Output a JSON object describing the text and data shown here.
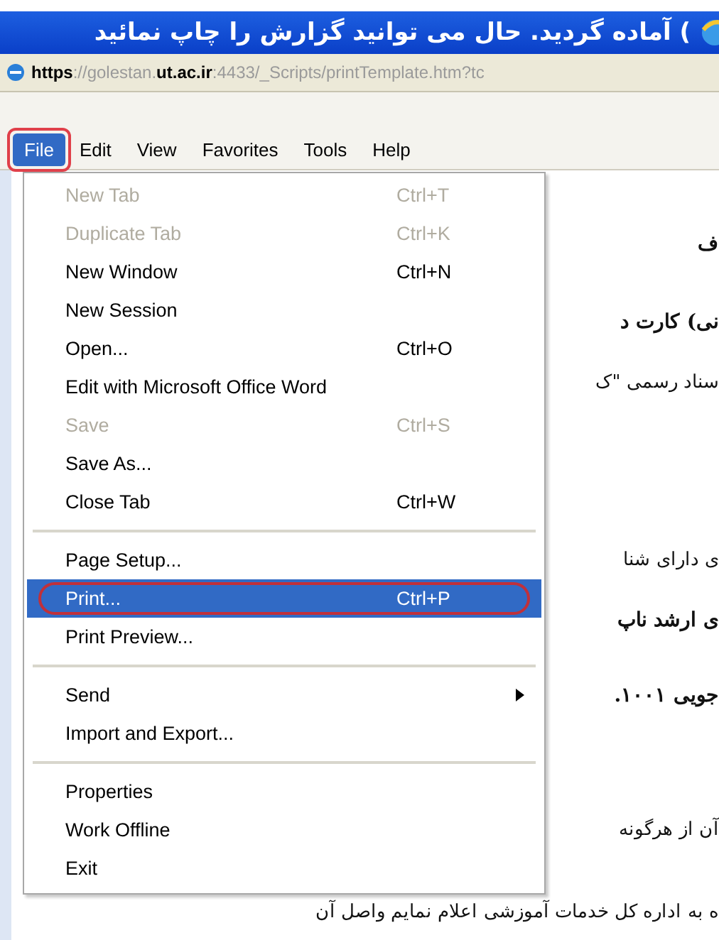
{
  "window": {
    "title": ") آماده گردید. حال می توانید گزارش را چاپ نمائید"
  },
  "address_bar": {
    "parts": [
      {
        "text": "https",
        "strong": true
      },
      {
        "text": "://golestan.",
        "strong": false
      },
      {
        "text": "ut.ac.ir",
        "strong": true
      },
      {
        "text": ":4433/_Scripts/printTemplate.htm?tc",
        "strong": false
      }
    ]
  },
  "menu_bar": [
    {
      "label": "File",
      "selected": true,
      "circled": true
    },
    {
      "label": "Edit",
      "selected": false,
      "circled": false
    },
    {
      "label": "View",
      "selected": false,
      "circled": false
    },
    {
      "label": "Favorites",
      "selected": false,
      "circled": false
    },
    {
      "label": "Tools",
      "selected": false,
      "circled": false
    },
    {
      "label": "Help",
      "selected": false,
      "circled": false
    }
  ],
  "file_menu": [
    {
      "kind": "item",
      "label": "New Tab",
      "shortcut": "Ctrl+T",
      "disabled": true,
      "selected": false,
      "circled": false,
      "submenu": false
    },
    {
      "kind": "item",
      "label": "Duplicate Tab",
      "shortcut": "Ctrl+K",
      "disabled": true,
      "selected": false,
      "circled": false,
      "submenu": false
    },
    {
      "kind": "item",
      "label": "New Window",
      "shortcut": "Ctrl+N",
      "disabled": false,
      "selected": false,
      "circled": false,
      "submenu": false
    },
    {
      "kind": "item",
      "label": "New Session",
      "disabled": false,
      "selected": false,
      "circled": false,
      "submenu": false
    },
    {
      "kind": "item",
      "label": "Open...",
      "shortcut": "Ctrl+O",
      "disabled": false,
      "selected": false,
      "circled": false,
      "submenu": false
    },
    {
      "kind": "item",
      "label": "Edit with Microsoft Office Word",
      "disabled": false,
      "selected": false,
      "circled": false,
      "submenu": false
    },
    {
      "kind": "item",
      "label": "Save",
      "shortcut": "Ctrl+S",
      "disabled": true,
      "selected": false,
      "circled": false,
      "submenu": false
    },
    {
      "kind": "item",
      "label": "Save As...",
      "disabled": false,
      "selected": false,
      "circled": false,
      "submenu": false
    },
    {
      "kind": "item",
      "label": "Close Tab",
      "shortcut": "Ctrl+W",
      "disabled": false,
      "selected": false,
      "circled": false,
      "submenu": false
    },
    {
      "kind": "separator"
    },
    {
      "kind": "item",
      "label": "Page Setup...",
      "disabled": false,
      "selected": false,
      "circled": false,
      "submenu": false
    },
    {
      "kind": "item",
      "label": "Print...",
      "shortcut": "Ctrl+P",
      "disabled": false,
      "selected": true,
      "circled": true,
      "submenu": false
    },
    {
      "kind": "item",
      "label": "Print Preview...",
      "disabled": false,
      "selected": false,
      "circled": false,
      "submenu": false
    },
    {
      "kind": "separator"
    },
    {
      "kind": "item",
      "label": "Send",
      "disabled": false,
      "selected": false,
      "circled": false,
      "submenu": true
    },
    {
      "kind": "item",
      "label": "Import and Export...",
      "disabled": false,
      "selected": false,
      "circled": false,
      "submenu": false
    },
    {
      "kind": "separator"
    },
    {
      "kind": "item",
      "label": "Properties",
      "disabled": false,
      "selected": false,
      "circled": false,
      "submenu": false
    },
    {
      "kind": "item",
      "label": "Work Offline",
      "disabled": false,
      "selected": false,
      "circled": false,
      "submenu": false
    },
    {
      "kind": "item",
      "label": "Exit",
      "disabled": false,
      "selected": false,
      "circled": false,
      "submenu": false
    }
  ],
  "document": {
    "lines": [
      {
        "text": "ف",
        "bold": true
      },
      {
        "text": "نی) کارت د",
        "bold": true
      },
      {
        "text": "سناد رسمی \"ک",
        "bold": false
      },
      {
        "text": "ی دارای شنا",
        "bold": false
      },
      {
        "text": "ی ارشد ناپ",
        "bold": true
      },
      {
        "text": "جویی ۱۰۰۱.",
        "bold": true
      },
      {
        "text": "آن از هرگونه",
        "bold": false
      },
      {
        "text": "ه به اداره کل خدمات آموزشی اعلام نمایم واصل آن",
        "bold": false
      }
    ]
  }
}
